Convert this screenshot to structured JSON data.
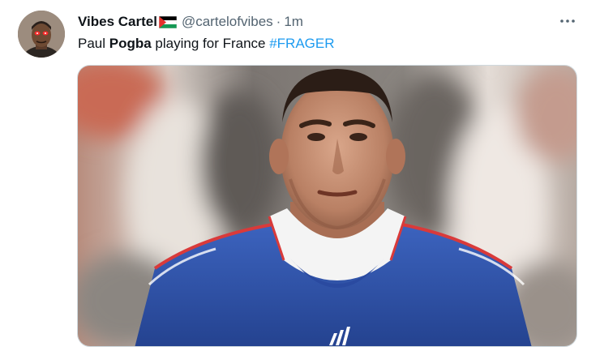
{
  "tweet": {
    "author": {
      "display_name": "Vibes Cartel",
      "handle": "@cartelofvibes",
      "flag_icon": "palestine-flag-icon"
    },
    "separator": "·",
    "time": "1m",
    "more_icon": "more-options-icon",
    "text": {
      "part1": "Paul ",
      "bold": "Pogba",
      "part2": " playing for France ",
      "hashtag": "#FRAGER"
    },
    "media": {
      "description_icon": "photo"
    }
  },
  "colors": {
    "link": "#1d9bf0",
    "primary_text": "#0f1419",
    "secondary_text": "#536471",
    "jersey_blue": "#2c4fa6"
  }
}
